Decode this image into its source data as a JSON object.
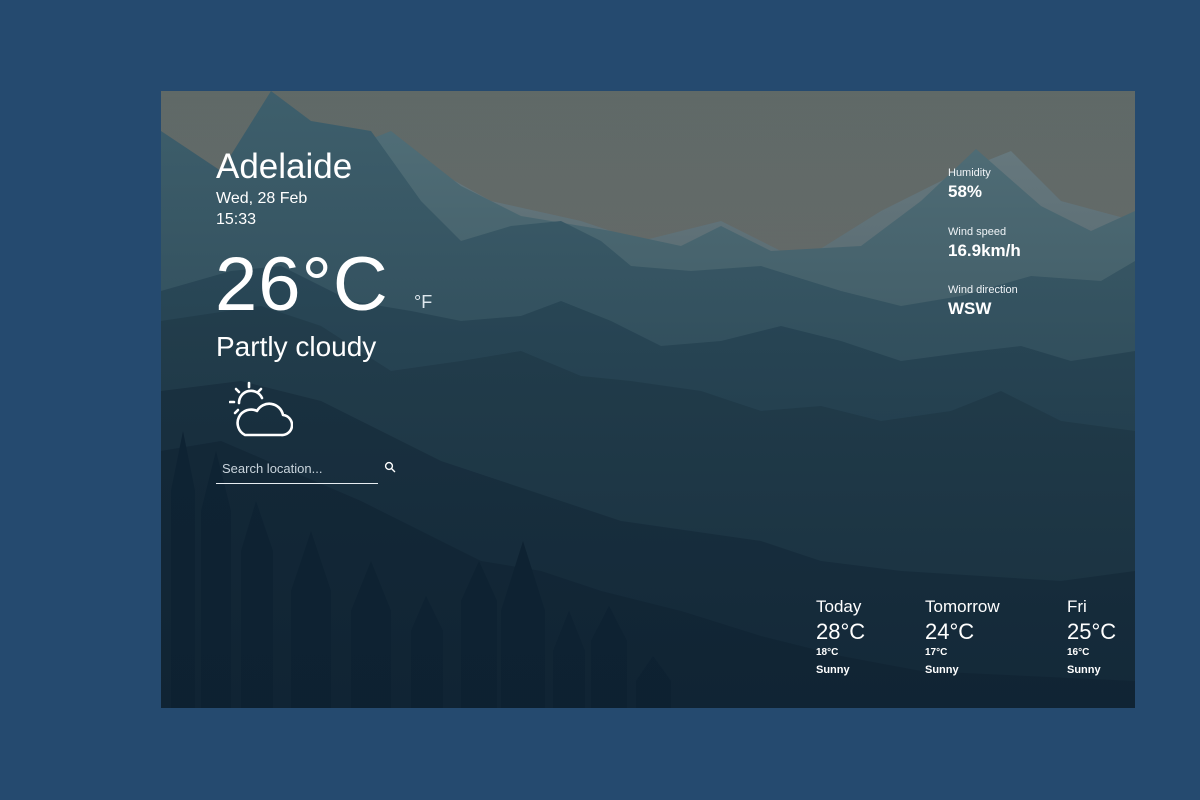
{
  "location": {
    "city": "Adelaide",
    "date": "Wed, 28 Feb",
    "time": "15:33"
  },
  "current": {
    "temperature": "26°C",
    "alt_unit": "°F",
    "condition": "Partly cloudy",
    "icon": "partly-cloudy-icon"
  },
  "search": {
    "placeholder": "Search location...",
    "icon": "search-icon"
  },
  "details": {
    "humidity": {
      "label": "Humidity",
      "value": "58%"
    },
    "wind_speed": {
      "label": "Wind speed",
      "value": "16.9km/h"
    },
    "wind_direction": {
      "label": "Wind direction",
      "value": "WSW"
    }
  },
  "forecast": [
    {
      "day": "Today",
      "high": "28°C",
      "low": "18°C",
      "condition": "Sunny"
    },
    {
      "day": "Tomorrow",
      "high": "24°C",
      "low": "17°C",
      "condition": "Sunny"
    },
    {
      "day": "Fri",
      "high": "25°C",
      "low": "16°C",
      "condition": "Sunny"
    }
  ],
  "colors": {
    "page_background": "#254a6f",
    "text": "#ffffff",
    "sky": "#8f8a83"
  }
}
